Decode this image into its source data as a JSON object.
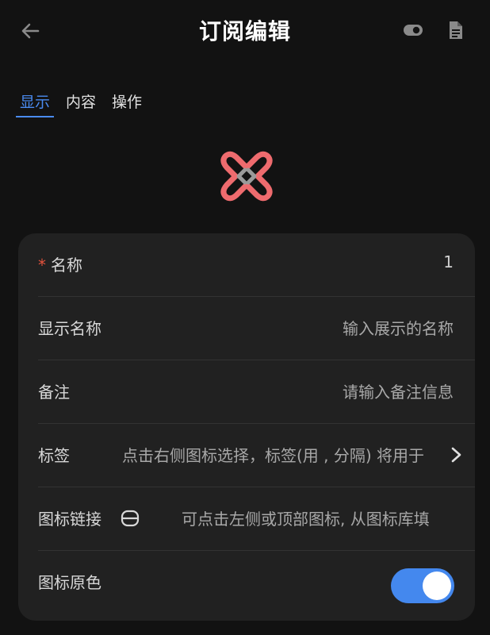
{
  "header": {
    "title": "订阅编辑"
  },
  "tabs": [
    {
      "label": "显示",
      "active": true
    },
    {
      "label": "内容",
      "active": false
    },
    {
      "label": "操作",
      "active": false
    }
  ],
  "icons": {
    "back": "arrow-left-icon",
    "toggle": "toggle-icon",
    "doc": "document-icon",
    "logo": "subscription-logo",
    "chevron": "chevron-right-icon",
    "library": "icon-library-icon"
  },
  "form": {
    "name": {
      "required_mark": "*",
      "label": "名称",
      "value": "1"
    },
    "display_name": {
      "label": "显示名称",
      "placeholder": "输入展示的名称"
    },
    "note": {
      "label": "备注",
      "placeholder": "请输入备注信息"
    },
    "tags": {
      "label": "标签",
      "placeholder": "点击右侧图标选择，标签(用 , 分隔) 将用于"
    },
    "icon_link": {
      "label": "图标链接",
      "placeholder": "可点击左侧或顶部图标, 从图标库填"
    },
    "icon_original_color": {
      "label": "图标原色",
      "enabled": true
    }
  },
  "colors": {
    "accent": "#4a8bf0",
    "required": "#e5533d",
    "logo": "#ee6b6e",
    "switch": "#4488ee"
  }
}
